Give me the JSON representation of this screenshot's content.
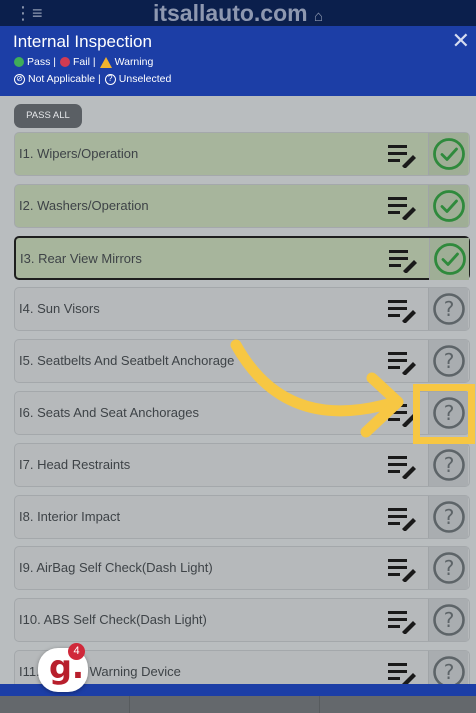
{
  "site_bar": {
    "menu_glyph": "⋮≡",
    "site_name": "itsallauto.com",
    "home_glyph": "⌂"
  },
  "modal": {
    "title": "Internal Inspection",
    "close_glyph": "✕",
    "legend": {
      "pass": "Pass |",
      "fail": "Fail |",
      "warning": "Warning",
      "not_applicable": "Not Applicable |",
      "unselected": "Unselected"
    }
  },
  "pass_all_label": "PASS ALL",
  "items": [
    {
      "label": "I1. Wipers/Operation",
      "status": "pass",
      "status_icon": "check-circle-icon"
    },
    {
      "label": "I2. Washers/Operation",
      "status": "pass",
      "status_icon": "check-circle-icon"
    },
    {
      "label": "I3. Rear View Mirrors",
      "status": "pass",
      "status_icon": "check-circle-icon"
    },
    {
      "label": "I4. Sun Visors",
      "status": "unselected",
      "status_icon": "question-circle-icon"
    },
    {
      "label": "I5. Seatbelts And Seatbelt Anchorage",
      "status": "unselected",
      "status_icon": "question-circle-icon"
    },
    {
      "label": "I6. Seats And Seat Anchorages",
      "status": "unselected",
      "status_icon": "question-circle-icon"
    },
    {
      "label": "I7. Head Restraints",
      "status": "unselected",
      "status_icon": "question-circle-icon"
    },
    {
      "label": "I8. Interior Impact",
      "status": "unselected",
      "status_icon": "question-circle-icon"
    },
    {
      "label": "I9. AirBag Self Check(Dash Light)",
      "status": "unselected",
      "status_icon": "question-circle-icon"
    },
    {
      "label": "I10. ABS Self Check(Dash Light)",
      "status": "unselected",
      "status_icon": "question-circle-icon"
    },
    {
      "label": "I11. Audible Warning Device",
      "status": "unselected",
      "status_icon": "question-circle-icon"
    }
  ],
  "logo": {
    "letter": "g.",
    "badge_count": "4"
  },
  "colors": {
    "header_blue": "#1c3ea6",
    "pass_green": "#2f8a3c",
    "unselected_gray": "#5d6468",
    "highlight_yellow": "#f7c743"
  }
}
